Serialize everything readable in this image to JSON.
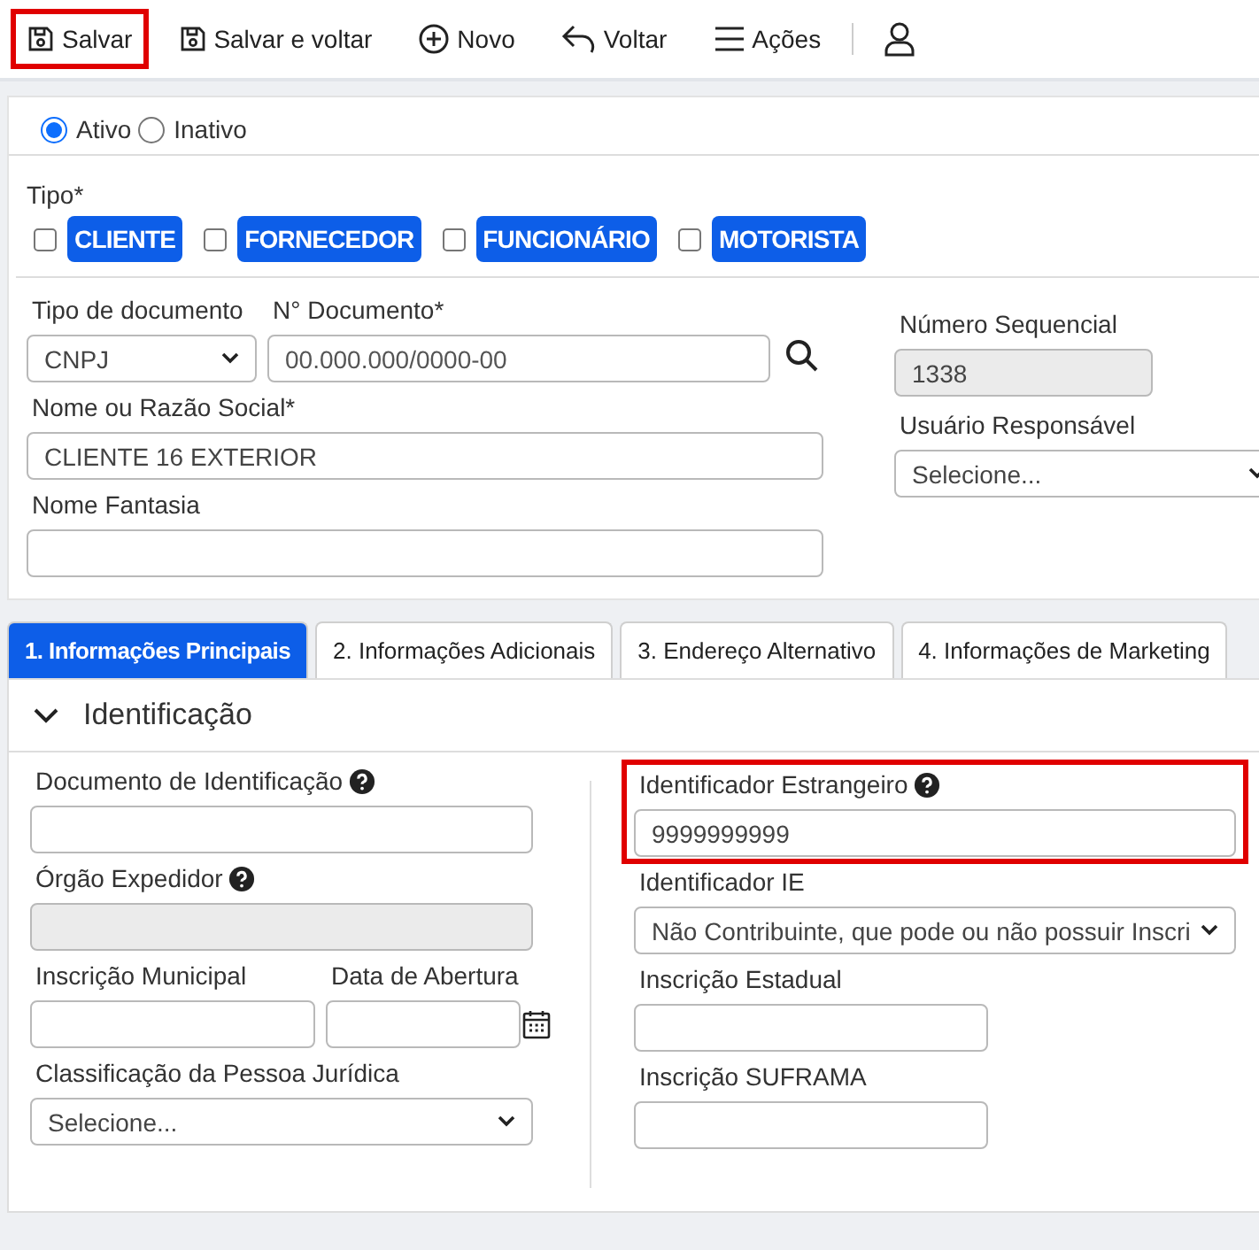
{
  "toolbar": [
    {
      "label": "Salvar",
      "highlighted": true
    },
    {
      "label": "Salvar e voltar",
      "highlighted": false
    },
    {
      "label": "Novo",
      "highlighted": false
    },
    {
      "label": "Voltar",
      "highlighted": false
    },
    {
      "label": "Ações",
      "highlighted": false
    },
    {
      "highlighted": false
    }
  ],
  "status": [
    {
      "label": "Ativo",
      "selected": true
    },
    {
      "label": "Inativo",
      "selected": false
    }
  ],
  "tipo": {
    "label": "Tipo*",
    "options": [
      {
        "label": "CLIENTE",
        "checked": false
      },
      {
        "label": "FORNECEDOR",
        "checked": false
      },
      {
        "label": "FUNCIONÁRIO",
        "checked": false
      },
      {
        "label": "MOTORISTA",
        "checked": false
      }
    ]
  },
  "main_form": {
    "tipo_documento": {
      "label": "Tipo de documento",
      "kind": "select",
      "value": "CNPJ"
    },
    "documento": {
      "label": "N° Documento*",
      "kind": "text",
      "placeholder": "00.000.000/0000-00"
    },
    "razao_social": {
      "label": "Nome ou Razão Social*",
      "kind": "text",
      "value": "CLIENTE 16 EXTERIOR"
    },
    "nome_fantasia": {
      "label": "Nome Fantasia",
      "kind": "text"
    },
    "numero_sequencial": {
      "label": "Número Sequencial",
      "kind": "text",
      "value": "1338",
      "disabled": true
    },
    "usuario_responsavel": {
      "label": "Usuário Responsável",
      "kind": "select",
      "value": "Selecione..."
    }
  },
  "tabs": [
    {
      "label": "1. Informações Principais",
      "selected": true
    },
    {
      "label": "2. Informações Adicionais",
      "selected": false
    },
    {
      "label": "3. Endereço Alternativo",
      "selected": false
    },
    {
      "label": "4. Informações de Marketing",
      "selected": false
    }
  ],
  "identificacao": {
    "title": "Identificação",
    "expanded": true,
    "documento_identificacao": {
      "label": "Documento de Identificação",
      "kind": "text",
      "help": true
    },
    "orgao_expedidor": {
      "label": "Órgão Expedidor",
      "kind": "text",
      "help": true,
      "disabled": true
    },
    "inscricao_municipal": {
      "label": "Inscrição Municipal",
      "kind": "text"
    },
    "data_abertura": {
      "label": "Data de Abertura",
      "kind": "date"
    },
    "classificacao": {
      "label": "Classificação da Pessoa Jurídica",
      "kind": "select",
      "value": "Selecione..."
    },
    "identificador_estrangeiro": {
      "label": "Identificador Estrangeiro",
      "kind": "text",
      "help": true,
      "value": "9999999999",
      "highlighted": true
    },
    "identificador_ie": {
      "label": "Identificador IE",
      "kind": "select",
      "value": "Não Contribuinte, que pode ou não possuir Inscri"
    },
    "inscricao_estadual": {
      "label": "Inscrição Estadual",
      "kind": "text"
    },
    "inscricao_suframa": {
      "label": "Inscrição SUFRAMA",
      "kind": "text"
    }
  }
}
